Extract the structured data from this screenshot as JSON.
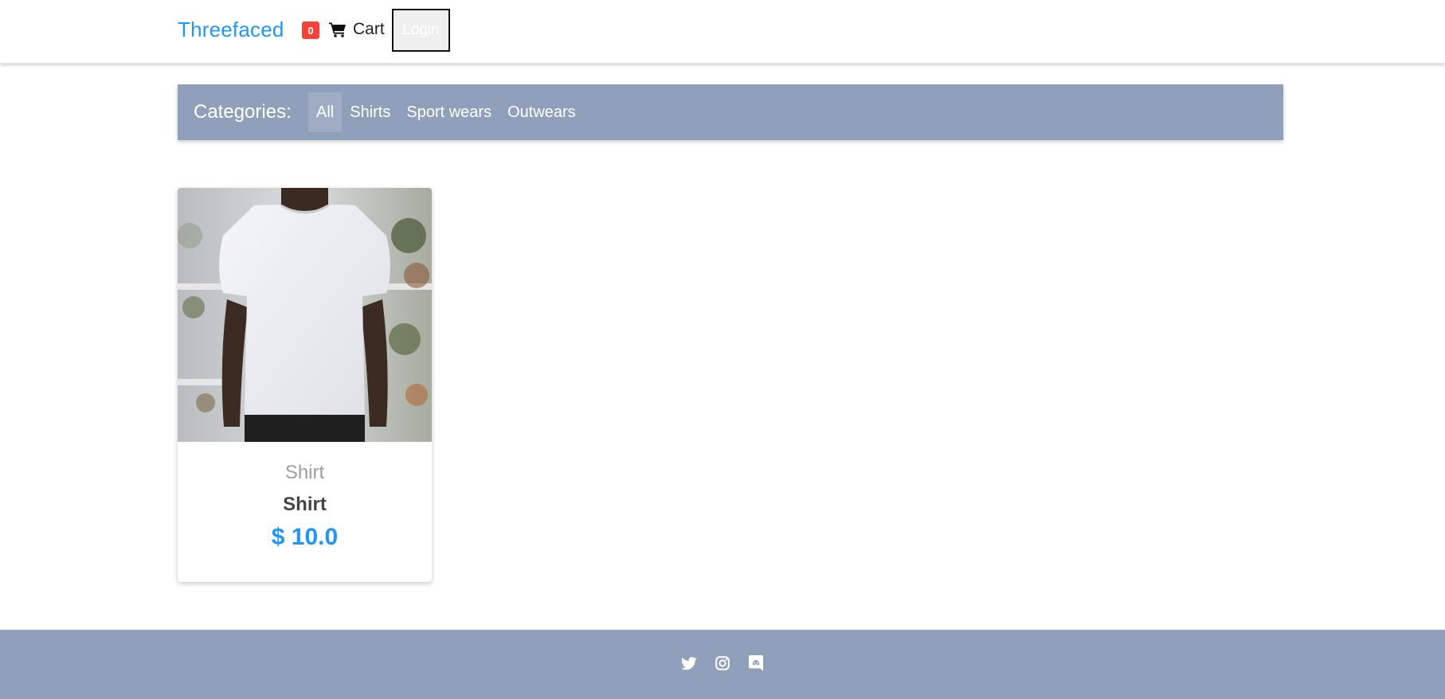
{
  "header": {
    "brand": "Threefaced",
    "cart_count": "0",
    "cart_label": "Cart",
    "login_label": "Login"
  },
  "categories": {
    "title": "Categories:",
    "items": [
      {
        "label": "All",
        "active": true
      },
      {
        "label": "Shirts",
        "active": false
      },
      {
        "label": "Sport wears",
        "active": false
      },
      {
        "label": "Outwears",
        "active": false
      }
    ]
  },
  "products": [
    {
      "category": "Shirt",
      "name": "Shirt",
      "price": "$ 10.0",
      "image": "white-tshirt-photo"
    }
  ],
  "footer": {
    "social_icons": [
      "twitter-icon",
      "instagram-icon",
      "discord-icon"
    ]
  },
  "colors": {
    "brand": "#2196f3",
    "badge": "#f44336",
    "bar": "#909fba",
    "price": "#2196f3"
  }
}
